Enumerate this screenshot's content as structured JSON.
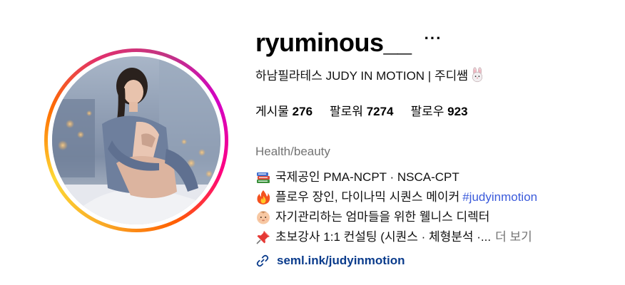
{
  "profile": {
    "username": "ryuminous__",
    "more_label": "···",
    "full_name": "하남필라테스 JUDY IN MOTION | 주디쌤",
    "stats": [
      {
        "label": "게시물",
        "value": "276"
      },
      {
        "label": "팔로워",
        "value": "7274"
      },
      {
        "label": "팔로우",
        "value": "923"
      }
    ],
    "category": "Health/beauty",
    "bio": {
      "line1": "국제공인 PMA-NCPT · NSCA-CPT",
      "line2_text": "플로우 장인, 다이나믹 시퀀스 메이커",
      "line2_hashtag": "#judyinmotion",
      "line3": "자기관리하는 엄마들을 위한 웰니스 디렉터",
      "line4": "초보강사 1:1 컨설팅 (시퀀스 · 체형분석 ·...",
      "more_label": "더 보기"
    },
    "link": "seml.ink/judyinmotion"
  },
  "icons": {
    "line1": "books-emoji",
    "line2": "fire-emoji",
    "line3": "baby-emoji",
    "line4": "pushpin-emoji",
    "name_suffix": "rabbit-face-emoji",
    "link": "link-icon"
  },
  "colors": {
    "hashtag": "#3b5bdb",
    "link": "#0b3c8c",
    "category": "#737373"
  }
}
